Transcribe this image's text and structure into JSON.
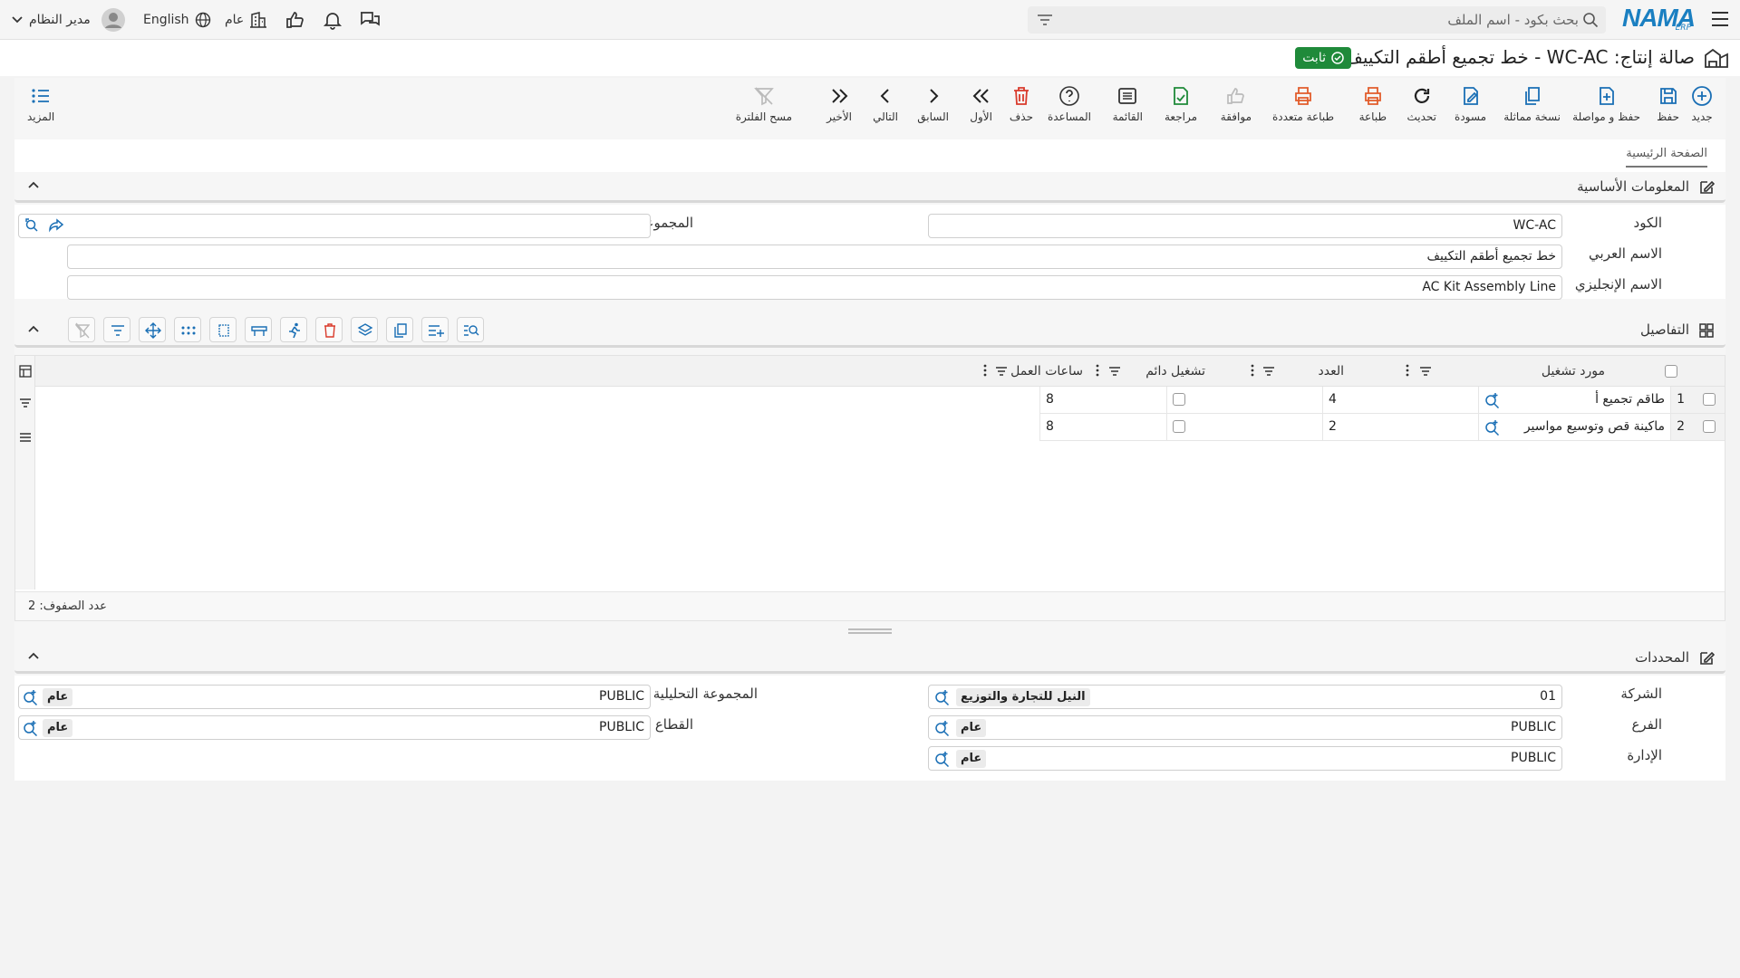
{
  "topbar": {
    "search_placeholder": "بحث بكود - اسم الملف",
    "logo": "NAMA",
    "logo_sub": "ERP",
    "user_name": "مدير النظام",
    "language": "English",
    "scope": "عام"
  },
  "title": {
    "text": "صالة إنتاج: WC-AC - خط تجميع أطقم التكييف",
    "status_badge": "ثابت"
  },
  "toolbar": {
    "buttons": [
      {
        "label": "جديد",
        "icon": "plus-circle-icon"
      },
      {
        "label": "حفظ",
        "icon": "save-icon"
      },
      {
        "label": "حفظ و مواصلة",
        "icon": "save-continue-icon"
      },
      {
        "label": "نسخة مماثلة",
        "icon": "duplicate-icon"
      },
      {
        "label": "مسودة",
        "icon": "draft-icon"
      },
      {
        "label": "تحديث",
        "icon": "refresh-icon"
      },
      {
        "label": "طباعة",
        "icon": "print-icon"
      },
      {
        "label": "طباعة متعددة",
        "icon": "multi-print-icon"
      },
      {
        "label": "موافقة",
        "icon": "approve-icon"
      },
      {
        "label": "مراجعة",
        "icon": "review-icon"
      },
      {
        "label": "القائمة",
        "icon": "list-icon"
      },
      {
        "label": "المساعدة",
        "icon": "help-icon"
      },
      {
        "label": "حذف",
        "icon": "delete-icon"
      },
      {
        "label": "الأول",
        "icon": "first-icon"
      },
      {
        "label": "السابق",
        "icon": "previous-icon"
      },
      {
        "label": "التالي",
        "icon": "next-icon"
      },
      {
        "label": "الأخير",
        "icon": "last-icon"
      },
      {
        "label": "مسح الفلترة",
        "icon": "clear-filter-icon"
      }
    ],
    "more_label": "المزيد"
  },
  "tabs": {
    "main": "الصفحة الرئيسية"
  },
  "basic_info": {
    "title": "المعلومات الأساسية",
    "code_label": "الكود",
    "code_value": "WC-AC",
    "group_label": "المجموعة",
    "group_value": "",
    "arabic_name_label": "الاسم العربي",
    "arabic_name_value": "خط تجميع أطقم التكييف",
    "english_name_label": "الاسم الإنجليزي",
    "english_name_value": "AC Kit Assembly Line"
  },
  "details": {
    "title": "التفاصيل",
    "columns": [
      "مورد تشغيل",
      "العدد",
      "تشغيل دائم",
      "ساعات العمل"
    ],
    "rows": [
      {
        "index": "1",
        "resource": "طاقم تجميع أ",
        "count": "4",
        "permanent": false,
        "hours": "8"
      },
      {
        "index": "2",
        "resource": "ماكينة قص وتوسيع مواسير",
        "count": "2",
        "permanent": false,
        "hours": "8"
      }
    ],
    "row_count_label": "عدد الصفوف: 2"
  },
  "dimensions": {
    "title": "المحددات",
    "company_label": "الشركة",
    "company_code": "01",
    "company_name": "النيل للتجارة والتوزيع",
    "branch_label": "الفرع",
    "branch_code": "PUBLIC",
    "branch_name": "عام",
    "department_label": "الإدارة",
    "department_code": "PUBLIC",
    "department_name": "عام",
    "analytic_label": "المجموعة التحليلية",
    "analytic_code": "PUBLIC",
    "analytic_name": "عام",
    "sector_label": "القطاع",
    "sector_code": "PUBLIC",
    "sector_name": "عام"
  },
  "colors": {
    "accent": "#1a6fb5",
    "success": "#1f8a3a",
    "danger": "#d93a2b",
    "print": "#e25c2b"
  }
}
